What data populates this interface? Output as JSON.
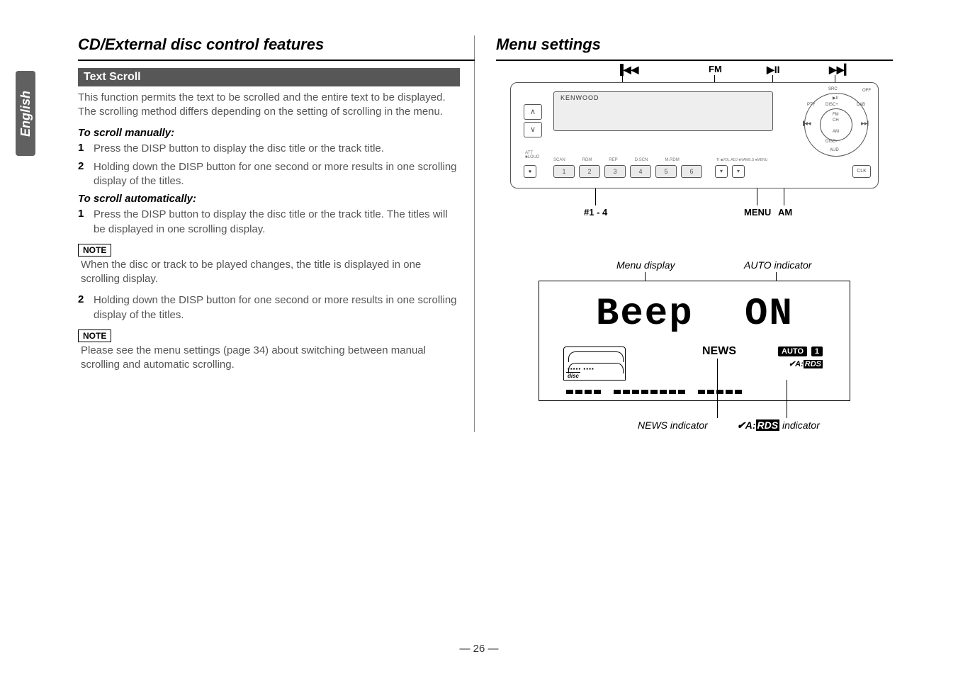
{
  "side_tab": "English",
  "page_number": "— 26 —",
  "left": {
    "title": "CD/External disc control features",
    "section_heading": "Text Scroll",
    "intro": "This function permits the text to be scrolled and the entire text to be displayed. The scrolling method differs depending on the setting of scrolling in the menu.",
    "manual_heading": "To scroll manually:",
    "manual_steps": [
      "Press the DISP button to display the disc title or the track title.",
      "Holding down the DISP button for one second or more results in one scrolling display of the titles."
    ],
    "auto_heading": "To scroll automatically:",
    "auto_step1": "Press the DISP button to display the disc title or the track title. The titles will be displayed in one scrolling display.",
    "note_label": "NOTE",
    "note1": "When the disc or track to be played changes, the title is displayed in one scrolling display.",
    "auto_step2": "Holding down the DISP button for one second or more results in one scrolling display of the titles.",
    "note2": "Please see the menu settings (page 34) about switching between manual scrolling and automatic scrolling."
  },
  "right": {
    "title": "Menu settings",
    "radio": {
      "brand": "KENWOOD",
      "top_callouts": {
        "prev": "▐◀◀",
        "fm": "FM",
        "playpause": "▶II",
        "next": "▶▶▎"
      },
      "dial_labels": {
        "src": "SRC",
        "off": "OFF",
        "play": "▶II",
        "pty": "PTY",
        "disc_up": "DISC+",
        "dab": "DAB",
        "fm": "FM",
        "ch": "CH",
        "prev": "▐◀◀",
        "next": "▶▶▎",
        "disc_down": "DISC-",
        "am": "AM",
        "aud": "AUD"
      },
      "small_row": [
        "SCAN",
        "RDM",
        "REP",
        "D.SCN",
        "M.RDM"
      ],
      "ti_labels": "TI   ■VOL.ADJ ●NAME.S ●MENU",
      "att": "ATT\n■LOUD",
      "preset_buttons": [
        "1",
        "2",
        "3",
        "4",
        "5",
        "6"
      ],
      "tiny_buttons": [
        "▾",
        "▾"
      ],
      "clk": "CLK",
      "dot_btn": "●",
      "bottom_callouts": {
        "presets": "#1 - 4",
        "menu": "MENU",
        "am": "AM"
      }
    },
    "display": {
      "callouts": {
        "menu_display": "Menu display",
        "auto_indicator": "AUTO indicator",
        "news_indicator": "NEWS indicator",
        "rds_indicator": " indicator"
      },
      "main_left": "Beep",
      "main_right": "ON",
      "news": "NEWS",
      "auto": "AUTO",
      "one": "1",
      "rds_prefix": "✔A:",
      "rds_box": "RDS",
      "disc_dots": "▪▪▪▪▪ ▪▪▪▪",
      "disc_label": "disc"
    }
  }
}
